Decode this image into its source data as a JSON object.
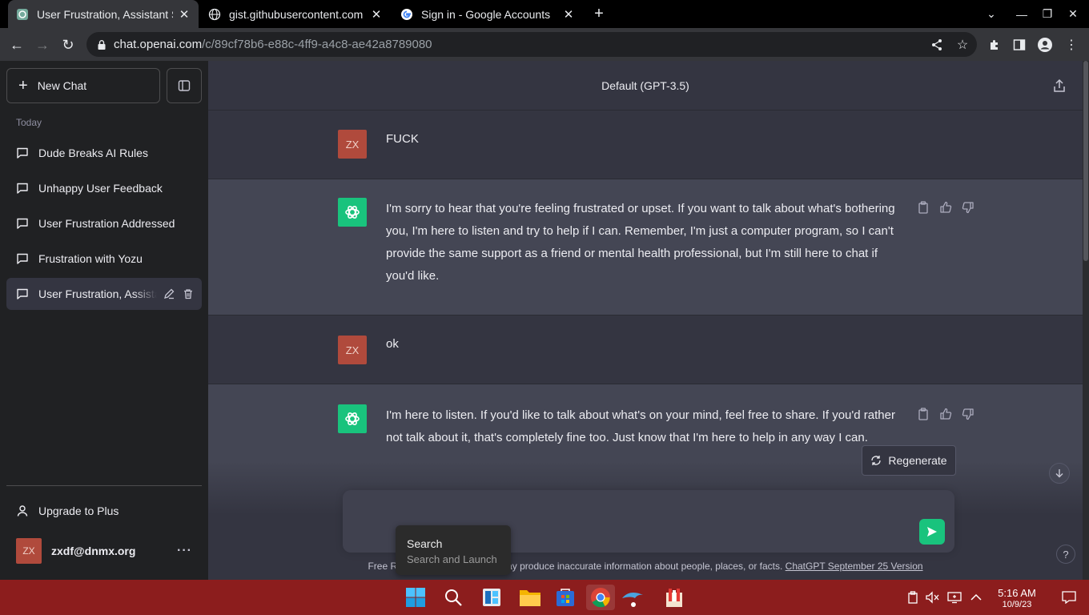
{
  "browser": {
    "tabs": [
      {
        "title": "User Frustration, Assistant S",
        "active": true
      },
      {
        "title": "gist.githubusercontent.com",
        "active": false
      },
      {
        "title": "Sign in - Google Accounts",
        "active": false
      }
    ],
    "url_host": "chat.openai.com",
    "url_path": "/c/89cf78b6-e88c-4ff9-a4c8-ae42a8789080"
  },
  "sidebar": {
    "new_chat_label": "New Chat",
    "section_label": "Today",
    "chats": [
      {
        "label": "Dude Breaks AI Rules"
      },
      {
        "label": "Unhappy User Feedback"
      },
      {
        "label": "User Frustration Addressed"
      },
      {
        "label": "Frustration with Yozu"
      },
      {
        "label": "User Frustration, Assistant Support"
      }
    ],
    "upgrade_label": "Upgrade to Plus",
    "account_initials": "ZX",
    "account_email": "zxdf@dnmx.org",
    "more_label": "···"
  },
  "main": {
    "model_label": "Default (GPT-3.5)",
    "messages": [
      {
        "role": "user",
        "avatar": "ZX",
        "text": "FUCK"
      },
      {
        "role": "assistant",
        "text": "I'm sorry to hear that you're feeling frustrated or upset. If you want to talk about what's bothering you, I'm here to listen and try to help if I can. Remember, I'm just a computer program, so I can't provide the same support as a friend or mental health professional, but I'm still here to chat if you'd like."
      },
      {
        "role": "user",
        "avatar": "ZX",
        "text": "ok"
      },
      {
        "role": "assistant",
        "text": "I'm here to listen. If you'd like to talk about what's on your mind, feel free to share. If you'd rather not talk about it, that's completely fine too. Just know that I'm here to help in any way I can."
      }
    ],
    "regenerate_label": "Regenerate",
    "composer_value": "",
    "disclaimer_prefix": "Free R",
    "disclaimer_text": "may produce inaccurate information about people, places, or facts.",
    "disclaimer_link": "ChatGPT September 25 Version",
    "help_label": "?"
  },
  "search_tooltip": {
    "title": "Search",
    "subtitle": "Search and Launch"
  },
  "taskbar": {
    "time": "5:16 AM",
    "date": "10/9/23"
  },
  "colors": {
    "accent_green": "#19c37d",
    "user_avatar": "#b04a3c",
    "taskbar": "#8c1d1d"
  }
}
